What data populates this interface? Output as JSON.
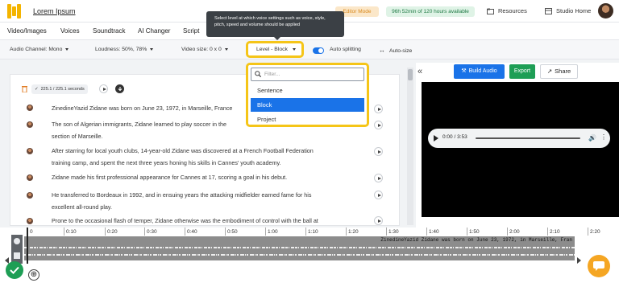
{
  "app": {
    "brand": "Lorem Ipsum",
    "editor_mode": "Editor Mode",
    "usage": "96h 52min of 120 hours available",
    "resources": "Resources",
    "studio_home": "Studio Home"
  },
  "menu": {
    "items": [
      "Video/Images",
      "Voices",
      "Soundtrack",
      "AI Changer",
      "Script"
    ]
  },
  "controls": {
    "audio_channel": "Audio Channel: Mono",
    "loudness": "Loudness: 50%, 78%",
    "video_size": "Video size: 0 x 0",
    "level": "Level - Block",
    "auto_splitting": "Auto splitting",
    "auto_size": "Auto-size",
    "auto_splitting_on": true
  },
  "tooltip": {
    "text": "Select level at which voice settings such as voice, style, pitch, speed and volume should be applied"
  },
  "level_dropdown": {
    "filter_placeholder": "Filter...",
    "options": [
      "Sentence",
      "Block",
      "Project"
    ],
    "selected": "Block"
  },
  "editor": {
    "duration": "225.1 / 225.1 seconds",
    "paragraphs": [
      {
        "lines": [
          "ZinedineYazid Zidane was born on June 23, 1972, in Marseille, France"
        ]
      },
      {
        "lines": [
          "The son of Algerian immigrants, Zidane learned to play soccer in the",
          "section of Marseille."
        ]
      },
      {
        "lines": [
          "After starring for local youth clubs, 14-year-old Zidane was discovered at a French Football Federation",
          "training camp, and spent the next three years honing his skills in Cannes' youth academy."
        ]
      },
      {
        "lines": [
          "Zidane made his first professional appearance for Cannes at 17, scoring a goal in his debut."
        ]
      },
      {
        "lines": [
          "He transferred to Bordeaux in 1992, and in ensuing years the attacking midfielder earned fame for his",
          "excellent all-round play."
        ]
      },
      {
        "lines": [
          "Prone to the occasional flash of temper, Zidane otherwise was the embodiment of control with the ball at"
        ]
      }
    ]
  },
  "right_panel": {
    "build_audio": "Build Audio",
    "export": "Export",
    "share": "Share",
    "audio_time": "0:00 / 3:53"
  },
  "timeline": {
    "ticks": [
      "0",
      "0:10",
      "0:20",
      "0:30",
      "0:40",
      "0:50",
      "1:00",
      "1:10",
      "1:20",
      "1:30",
      "1:40",
      "1:50",
      "2:00",
      "2:10",
      "2:20"
    ],
    "track_caption": "ZinedineYazid Zidane was born on June 23, 1972, in Marseille, Fran"
  },
  "colors": {
    "accent": "#1a73e8",
    "highlight": "#f5c518",
    "export_green": "#1e9e55",
    "chat_orange": "#f5a623"
  }
}
